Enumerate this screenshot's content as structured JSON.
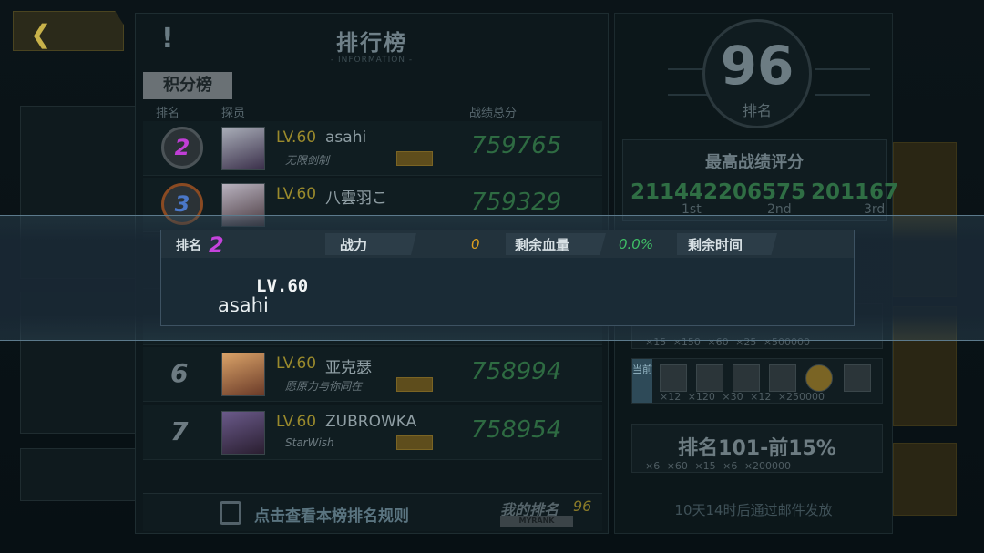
{
  "ranking": {
    "title": "排行榜",
    "subtitle": "- INFORMATION -",
    "tab": "积分榜",
    "columns": {
      "rank": "排名",
      "member": "探员",
      "total": "战绩总分"
    },
    "rows": [
      {
        "rank": "2",
        "level": "LV.60",
        "name": "asahi",
        "guild": "无限剑制",
        "score": "759765"
      },
      {
        "rank": "3",
        "level": "LV.60",
        "name": "八雲羽こ",
        "guild": "",
        "score": "759329"
      },
      {
        "rank": "6",
        "level": "LV.60",
        "name": "亚克瑟",
        "guild": "愿原力与你同在",
        "score": "758994"
      },
      {
        "rank": "7",
        "level": "LV.60",
        "name": "ZUBROWKA",
        "guild": "StarWish",
        "score": "758954"
      }
    ],
    "footer": {
      "rules": "点击查看本榜排名规则",
      "my_rank_label": "我的排名",
      "my_rank_value": "96",
      "my_rank_en": "MYRANK"
    }
  },
  "side": {
    "rank_number": "96",
    "rank_label": "排名",
    "best_title": "最高战绩评分",
    "best_scores": [
      {
        "score": "211442",
        "place": "1st"
      },
      {
        "score": "206575",
        "place": "2nd"
      },
      {
        "score": "201167",
        "place": "3rd"
      }
    ],
    "reward_rows": [
      {
        "counts": "×15  ×150  ×60  ×25  ×500000"
      },
      {
        "current_label": "当前",
        "counts": "×12  ×120  ×30  ×12  ×250000"
      },
      {
        "title": "排名101-前15%",
        "counts": "×6  ×60  ×15  ×6  ×200000"
      }
    ],
    "mail_note": "10天14时后通过邮件发放"
  },
  "banner": {
    "rank_label": "排名",
    "rank_value": "2",
    "power_label": "战力",
    "power_value": "0",
    "hp_label": "剩余血量",
    "hp_value": "0.0%",
    "time_label": "剩余时间",
    "level": "LV.60",
    "name": "asahi"
  },
  "colors": {
    "score_green": "#2e6b42",
    "highlight_purple": "#c543dc",
    "power_orange": "#e0a11e",
    "hp_green": "#3fbf66"
  }
}
